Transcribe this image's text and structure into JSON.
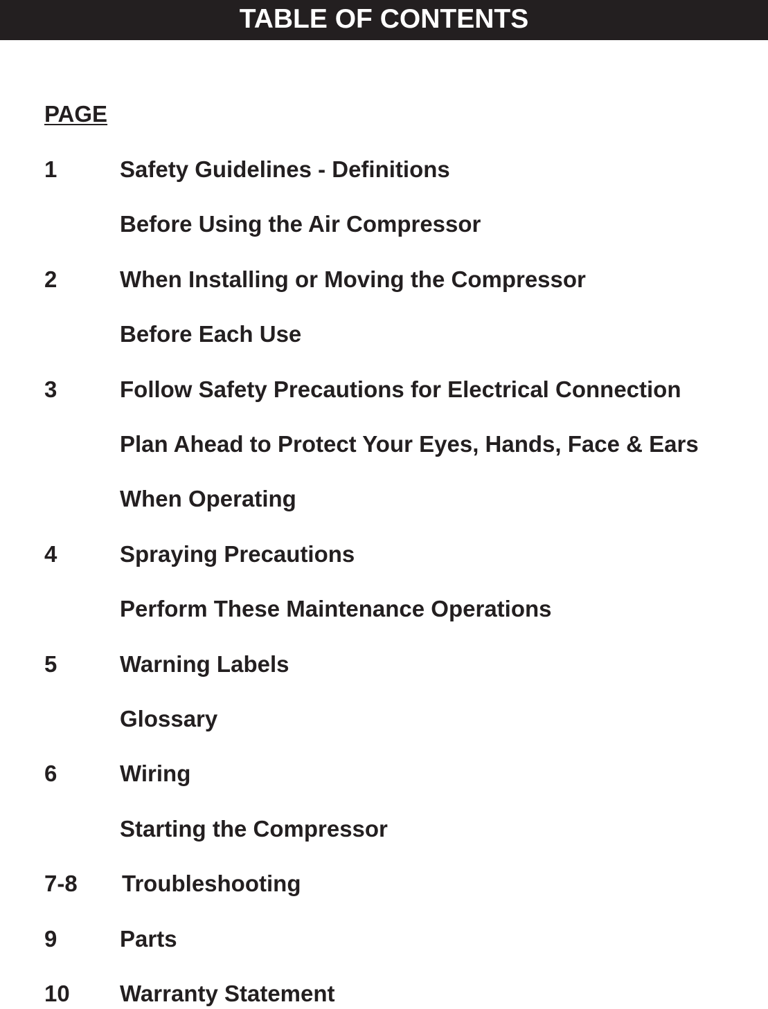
{
  "header": {
    "title": "TABLE OF CONTENTS",
    "background_color": "#231f20",
    "text_color": "#ffffff"
  },
  "page_column_label": "PAGE",
  "entries": [
    {
      "page": "1",
      "title": "Safety Guidelines - Definitions"
    },
    {
      "page": "",
      "title": "Before Using the Air Compressor"
    },
    {
      "page": "2",
      "title": "When Installing or Moving the Compressor"
    },
    {
      "page": "",
      "title": "Before Each Use"
    },
    {
      "page": "3",
      "title": "Follow Safety Precautions for Electrical Connection"
    },
    {
      "page": "",
      "title": "Plan Ahead to Protect Your Eyes, Hands, Face & Ears"
    },
    {
      "page": "",
      "title": "When Operating"
    },
    {
      "page": "4",
      "title": "Spraying Precautions"
    },
    {
      "page": "",
      "title": "Perform These Maintenance Operations"
    },
    {
      "page": "5",
      "title": "Warning Labels"
    },
    {
      "page": "",
      "title": "Glossary"
    },
    {
      "page": "6",
      "title": "Wiring"
    },
    {
      "page": "",
      "title": "Starting the Compressor"
    },
    {
      "page": "7-8",
      "title": "Troubleshooting"
    },
    {
      "page": "9",
      "title": "Parts"
    },
    {
      "page": "10",
      "title": "Warranty Statement"
    }
  ]
}
